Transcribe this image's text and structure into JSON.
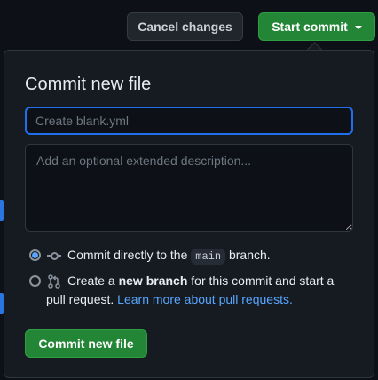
{
  "header": {
    "cancel_label": "Cancel changes",
    "start_commit_label": "Start commit"
  },
  "commit_panel": {
    "title": "Commit new file",
    "summary_placeholder": "Create blank.yml",
    "summary_value": "",
    "description_placeholder": "Add an optional extended description...",
    "option_direct": {
      "selected": true,
      "prefix": "Commit directly to the",
      "branch": "main",
      "suffix": "branch."
    },
    "option_new_branch": {
      "selected": false,
      "prefix": "Create a",
      "bold": "new branch",
      "middle": "for this commit and start a",
      "line2": "pull request.",
      "link": "Learn more about pull requests."
    },
    "submit_label": "Commit new file"
  },
  "icons": {
    "commit": "git-commit-icon",
    "pull_request": "git-pull-request-icon",
    "dropdown": "triangle-down-icon"
  },
  "colors": {
    "primary_green": "#238636",
    "accent_blue": "#1f6feb",
    "link_blue": "#58a6ff",
    "background": "#0d1117",
    "panel": "#161b22"
  }
}
